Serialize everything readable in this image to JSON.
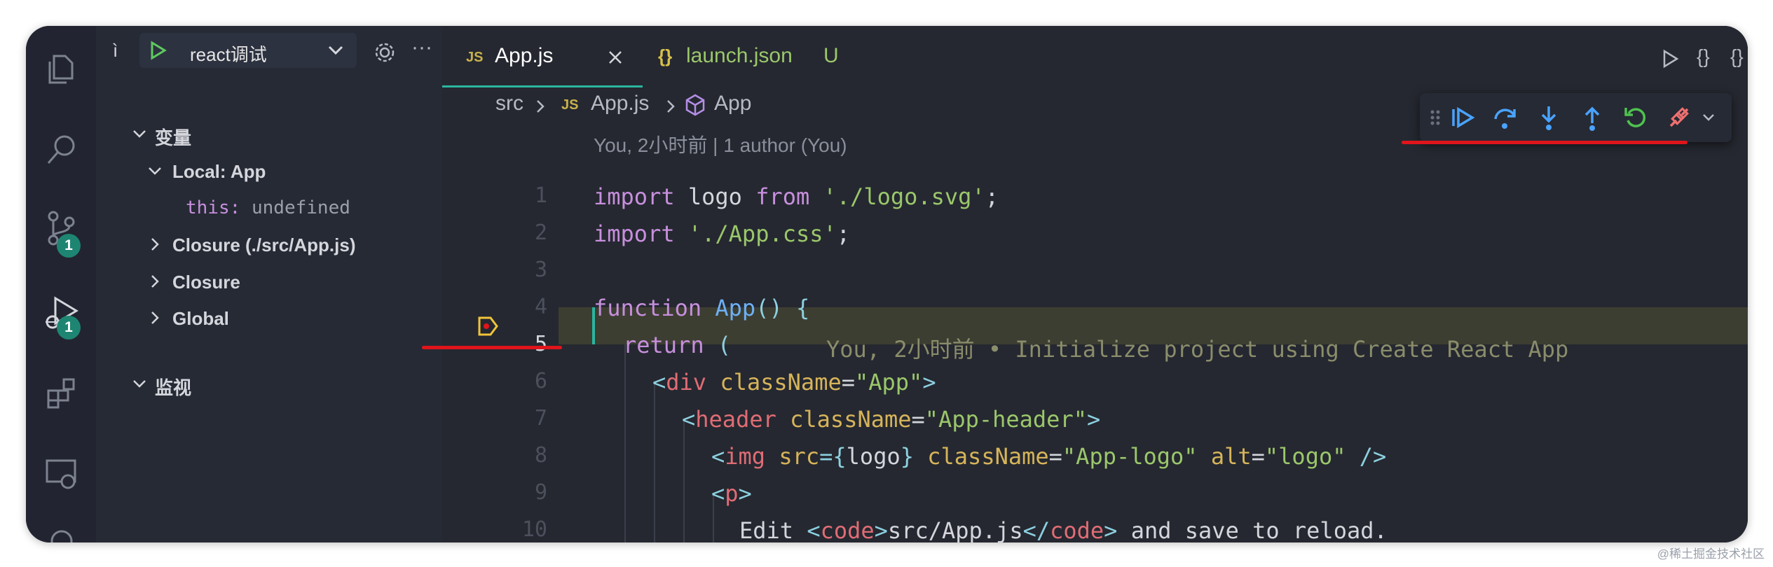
{
  "activity_bar": {
    "scm_badge": "1",
    "debug_badge": "1"
  },
  "sidebar": {
    "header": {
      "truncated_label": "ì",
      "config_name": "react调试"
    },
    "variables_section": "变量",
    "scopes": [
      {
        "label": "Local: App",
        "expanded": true
      },
      {
        "label": "Closure (./src/App.js)",
        "expanded": false
      },
      {
        "label": "Closure",
        "expanded": false
      },
      {
        "label": "Global",
        "expanded": false
      }
    ],
    "local_var": {
      "name": "this:",
      "value": "undefined"
    },
    "watch_section": "监视"
  },
  "tabs": [
    {
      "icon": "JS",
      "label": "App.js",
      "active": true
    },
    {
      "icon": "{}",
      "label": "launch.json",
      "status": "U",
      "active": false
    }
  ],
  "breadcrumb": {
    "folder": "src",
    "file_icon": "JS",
    "file": "App.js",
    "symbol": "App"
  },
  "blame_header": "You, 2小时前 | 1 author (You)",
  "line5_blame": "You, 2小时前 • Initialize project using Create React App",
  "line_numbers": [
    "1",
    "2",
    "3",
    "4",
    "5",
    "6",
    "7",
    "8",
    "9",
    "10"
  ],
  "code": {
    "l1": [
      "import",
      " logo ",
      "from",
      " ",
      "'./logo.svg'",
      ";"
    ],
    "l2": [
      "import",
      " ",
      "'./App.css'",
      ";"
    ],
    "l4": [
      "function",
      " ",
      "App",
      "()",
      " {"
    ],
    "l5": [
      "return",
      " ("
    ],
    "l6": [
      "<",
      "div",
      " ",
      "className",
      "=",
      "\"App\"",
      ">"
    ],
    "l7": [
      "<",
      "header",
      " ",
      "className",
      "=",
      "\"App-header\"",
      ">"
    ],
    "l8": [
      "<",
      "img",
      " ",
      "src",
      "={",
      "logo",
      "}",
      " ",
      "className",
      "=",
      "\"App-logo\"",
      " ",
      "alt",
      "=",
      "\"logo\"",
      " />"
    ],
    "l9": [
      "<",
      "p",
      ">"
    ],
    "l10": [
      "Edit ",
      "<",
      "code",
      ">",
      "src/App.js",
      "</",
      "code",
      ">",
      " and save to reload."
    ]
  },
  "colors": {
    "accent": "#2bb5a0",
    "annotation_red": "#e0151b",
    "breakpoint_yellow": "#f0c43a"
  },
  "watermark": "@稀土掘金技术社区"
}
